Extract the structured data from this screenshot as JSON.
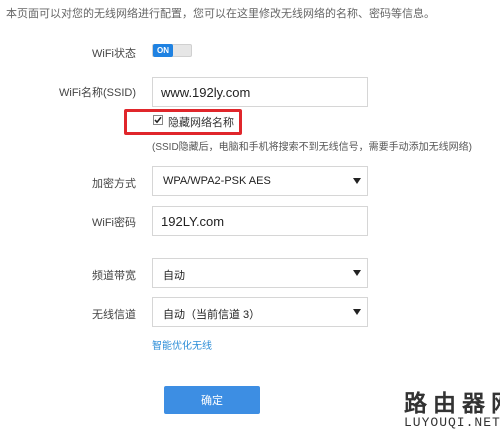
{
  "intro": "本页面可以对您的无线网络进行配置，您可以在这里修改无线网络的名称、密码等信息。",
  "wifi_status": {
    "label": "WiFi状态",
    "state": "ON",
    "enabled": true
  },
  "ssid": {
    "label": "WiFi名称(SSID)",
    "value": "www.192ly.com"
  },
  "hide_ssid": {
    "label": "隐藏网络名称",
    "checked": true,
    "hint": "(SSID隐藏后，电脑和手机将搜索不到无线信号，需要手动添加无线网络)"
  },
  "encryption": {
    "label": "加密方式",
    "value": "WPA/WPA2-PSK AES"
  },
  "password": {
    "label": "WiFi密码",
    "value": "192LY.com"
  },
  "bandwidth": {
    "label": "频道带宽",
    "value": "自动"
  },
  "channel": {
    "label": "无线信道",
    "value": "自动（当前信道 3）"
  },
  "smart_optimize": "智能优化无线",
  "confirm_label": "确定",
  "watermark": {
    "cn": "路由器网",
    "en": "LUYOUQI.NET"
  },
  "colors": {
    "accent": "#3d8ee3",
    "highlight": "#e0262b",
    "link": "#2f8fd8"
  }
}
